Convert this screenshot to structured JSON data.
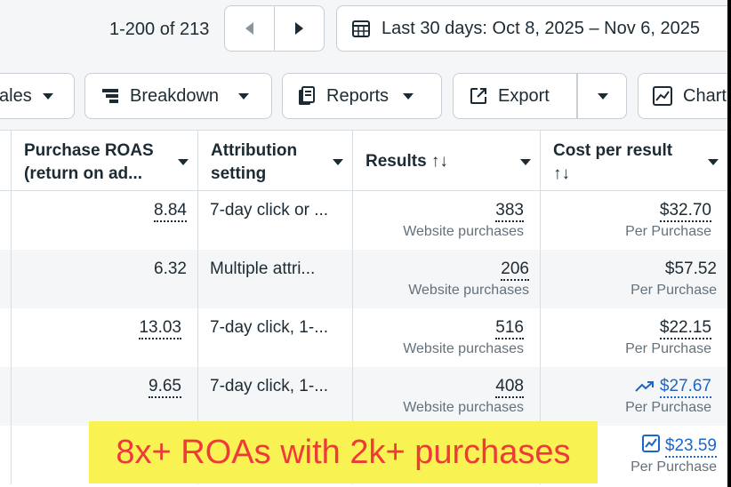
{
  "pagination": {
    "range_text": "1-200 of 213"
  },
  "date_range": {
    "label": "Last 30 days: Oct 8, 2025 – Nov 6, 2025"
  },
  "toolbar": {
    "sales_label": "ales",
    "breakdown_label": "Breakdown",
    "reports_label": "Reports",
    "export_label": "Export",
    "chart_label": "Chart"
  },
  "table": {
    "headers": {
      "roas_line1": "Purchase ROAS",
      "roas_line2": "(return on ad...",
      "attr_line1": "Attribution",
      "attr_line2": "setting",
      "results": "Results ↑↓",
      "cost_line1": "Cost per result",
      "cost_line2": "↑↓"
    },
    "rows": [
      {
        "roas": "8.84",
        "attribution": "7-day click or ...",
        "results": "383",
        "results_sub": "Website purchases",
        "cost": "$32.70",
        "cost_sub": "Per Purchase"
      },
      {
        "roas": "6.32",
        "attribution": "Multiple attri...",
        "results": "206",
        "results_sub": "Website purchases",
        "cost": "$57.52",
        "cost_sub": "Per Purchase"
      },
      {
        "roas": "13.03",
        "attribution": "7-day click, 1-...",
        "results": "516",
        "results_sub": "Website purchases",
        "cost": "$22.15",
        "cost_sub": "Per Purchase"
      },
      {
        "roas": "9.65",
        "attribution": "7-day click, 1-...",
        "results": "408",
        "results_sub": "Website purchases",
        "cost": "$27.67",
        "cost_sub": "Per Purchase"
      },
      {
        "cost": "$23.59",
        "cost_sub": "Per Purchase"
      }
    ]
  },
  "annotation": {
    "text": "8x+ ROAs with 2k+  purchases"
  },
  "colors": {
    "link": "#1a66c9",
    "highlight_bg": "#f8f252",
    "highlight_text": "#ee3a3a"
  }
}
